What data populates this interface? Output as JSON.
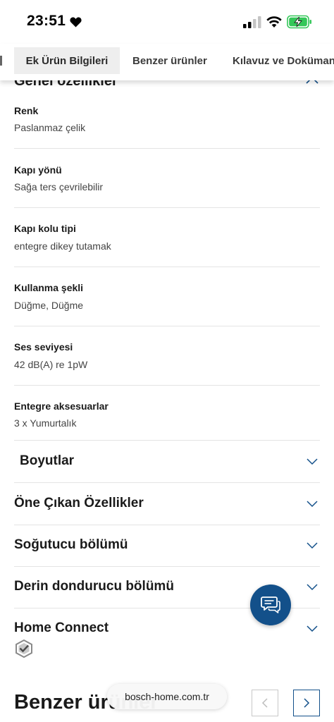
{
  "status_bar": {
    "time": "23:51",
    "icons": [
      "heart-icon",
      "signal-icon",
      "wifi-icon",
      "battery-charging-icon"
    ]
  },
  "tabs": [
    {
      "label": "Ek Ürün Bilgileri",
      "active": true
    },
    {
      "label": "Benzer ürünler",
      "active": false
    },
    {
      "label": "Kılavuz ve Dokümanlar",
      "active": false
    }
  ],
  "section": {
    "title": "Genel özellikler"
  },
  "specs": [
    {
      "label": "Renk",
      "value": "Paslanmaz çelik"
    },
    {
      "label": "Kapı yönü",
      "value": "Sağa ters çevrilebilir"
    },
    {
      "label": "Kapı kolu tipi",
      "value": "entegre dikey tutamak"
    },
    {
      "label": "Kullanma şekli",
      "value": "Düğme, Düğme"
    },
    {
      "label": "Ses seviyesi",
      "value": "42 dB(A) re 1pW"
    },
    {
      "label": "Entegre aksesuarlar",
      "value": "3 x Yumurtalık"
    }
  ],
  "accordions": [
    {
      "title": "Boyutlar"
    },
    {
      "title": "Öne Çıkan Özellikler"
    },
    {
      "title": "Soğutucu bölümü"
    },
    {
      "title": "Derin dondurucu bölümü"
    },
    {
      "title": "Home Connect"
    }
  ],
  "bottom": {
    "title": "Benzer ürünler",
    "url": "bosch-home.com.tr"
  },
  "colors": {
    "accent": "#13508a",
    "divider": "#e4e4e4",
    "active_tab_bg": "#eeeeee"
  }
}
